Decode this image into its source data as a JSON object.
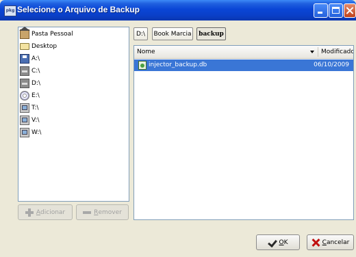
{
  "window": {
    "title": "Selecione o Arquivo de Backup",
    "app_icon_text": "pkg"
  },
  "places": {
    "items": [
      {
        "label": "Pasta Pessoal",
        "icon": "home-icon"
      },
      {
        "label": "Desktop",
        "icon": "folder-icon"
      },
      {
        "label": "A:\\",
        "icon": "floppy-icon"
      },
      {
        "label": "C:\\",
        "icon": "hard-drive-icon"
      },
      {
        "label": "D:\\",
        "icon": "hard-drive-icon"
      },
      {
        "label": "E:\\",
        "icon": "cd-drive-icon"
      },
      {
        "label": "T:\\",
        "icon": "network-drive-icon"
      },
      {
        "label": "V:\\",
        "icon": "network-drive-icon"
      },
      {
        "label": "W:\\",
        "icon": "network-drive-icon"
      }
    ],
    "add_button": {
      "label_u": "A",
      "label_rest": "dicionar"
    },
    "remove_button": {
      "label_u": "R",
      "label_rest": "emover"
    }
  },
  "path_bar": {
    "segments": [
      "D:\\",
      "Book Marcia",
      "backup"
    ]
  },
  "file_list": {
    "columns": {
      "name": "Nome",
      "modified": "Modificado"
    },
    "rows": [
      {
        "name": "injector_backup.db",
        "modified": "06/10/2009",
        "selected": true
      }
    ]
  },
  "actions": {
    "ok": {
      "label_u": "O",
      "label_rest": "K"
    },
    "cancel": {
      "label_u": "C",
      "label_rest": "ancelar"
    }
  },
  "colors": {
    "titlebar": "#0a46d6",
    "selection": "#3a76d6",
    "panel_border": "#7f9db9"
  }
}
